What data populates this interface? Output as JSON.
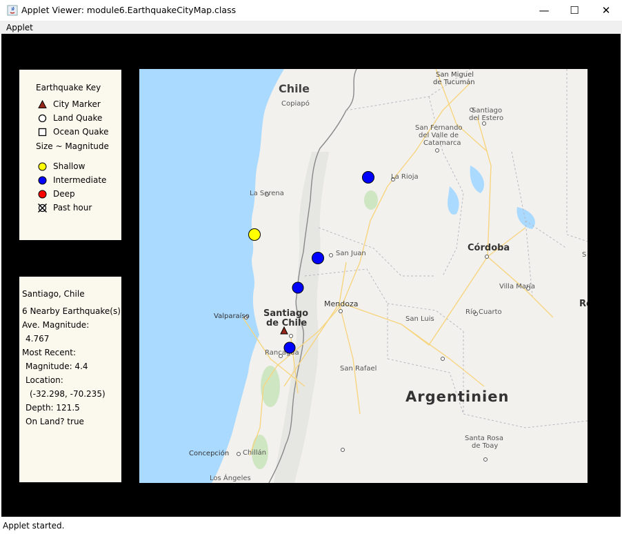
{
  "window": {
    "title": "Applet Viewer: module6.EarthquakeCityMap.class",
    "minimize": "—",
    "maximize": "☐",
    "close": "✕"
  },
  "menu": {
    "applet": "Applet"
  },
  "key": {
    "title": "Earthquake Key",
    "city_marker": "City Marker",
    "land_quake": "Land Quake",
    "ocean_quake": "Ocean Quake",
    "size_note": "Size ~ Magnitude",
    "shallow": "Shallow",
    "intermediate": "Intermediate",
    "deep": "Deep",
    "past_hour": "Past hour"
  },
  "colors": {
    "shallow": "#ffff00",
    "intermediate": "#0000ff",
    "deep": "#ff0000",
    "city_marker": "#96281b",
    "water": "#aadaff",
    "panel_bg": "#fbf8ee"
  },
  "info": {
    "city": "Santiago, Chile",
    "nearby": "6 Nearby Earthquake(s)",
    "ave_label": "Ave. Magnitude:",
    "ave_value": "4.767",
    "recent_label": "Most Recent:",
    "magnitude": "Magnitude: 4.4",
    "location_label": "Location:",
    "location_value": "(-32.298, -70.235)",
    "depth": "Depth: 121.5",
    "on_land": "On Land? true"
  },
  "map_labels": {
    "chile": "Chile",
    "copiapo": "Copiapó",
    "la_serena": "La Serena",
    "valparaiso": "Valparaíso",
    "santiago_1": "Santiago",
    "santiago_2": "de Chile",
    "rancagua": "Rancagua",
    "concepcion": "Concepción",
    "chillan": "Chillán",
    "los_angeles": "Los Ángeles",
    "san_miguel_1": "San Miguel",
    "san_miguel_2": "de Tucumán",
    "santiago_estero_1": "Santiago",
    "santiago_estero_2": "del Estero",
    "catamarca_1": "San Fernando",
    "catamarca_2": "del Valle de",
    "catamarca_3": "Catamarca",
    "la_rioja": "La Rioja",
    "cordoba": "Córdoba",
    "san_juan": "San Juan",
    "villa_maria": "Villa María",
    "mendoza": "Mendoza",
    "san_luis": "San Luis",
    "rio_cuarto": "Río Cuarto",
    "san_rafael": "San Rafael",
    "argentinien": "Argentinien",
    "santa_rosa_1": "Santa Rosa",
    "santa_rosa_2": "de Toay",
    "edge_s": "S",
    "edge_ro": "Ro"
  },
  "quakes": [
    {
      "category": "intermediate"
    },
    {
      "category": "shallow"
    },
    {
      "category": "intermediate"
    },
    {
      "category": "intermediate"
    },
    {
      "category": "intermediate"
    }
  ],
  "status": "Applet started."
}
